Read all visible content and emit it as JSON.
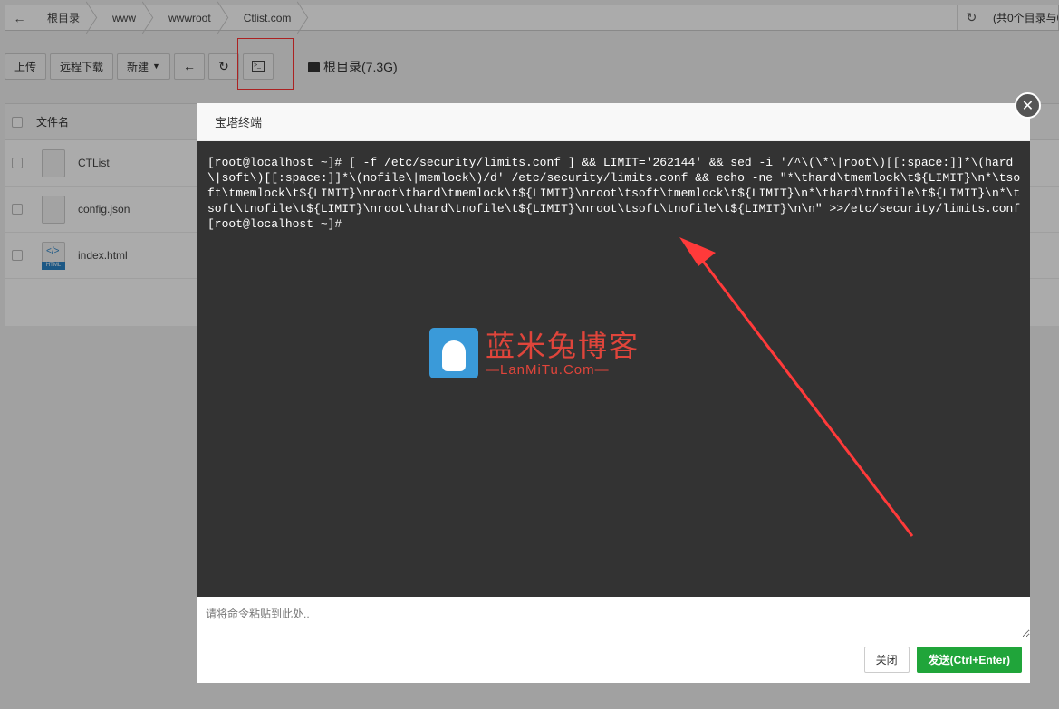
{
  "breadcrumb": {
    "items": [
      "根目录",
      "www",
      "wwwroot",
      "Ctlist.com"
    ],
    "info": "(共0个目录与0"
  },
  "toolbar": {
    "upload": "上传",
    "remote_download": "远程下载",
    "new": "新建",
    "disk_label": "根目录(7.3G)"
  },
  "filelist": {
    "header_name": "文件名",
    "files": [
      {
        "name": "CTList",
        "type": "file"
      },
      {
        "name": "config.json",
        "type": "file"
      },
      {
        "name": "index.html",
        "type": "html",
        "tag": "HTML"
      }
    ]
  },
  "modal": {
    "title": "宝塔终端",
    "terminal_lines": "[root@localhost ~]# [ -f /etc/security/limits.conf ] && LIMIT='262144' && sed -i '/^\\(\\*\\|root\\)[[:space:]]*\\(hard\\|soft\\)[[:space:]]*\\(nofile\\|memlock\\)/d' /etc/security/limits.conf && echo -ne \"*\\thard\\tmemlock\\t${LIMIT}\\n*\\tsoft\\tmemlock\\t${LIMIT}\\nroot\\thard\\tmemlock\\t${LIMIT}\\nroot\\tsoft\\tmemlock\\t${LIMIT}\\n*\\thard\\tnofile\\t${LIMIT}\\n*\\tsoft\\tnofile\\t${LIMIT}\\nroot\\thard\\tnofile\\t${LIMIT}\\nroot\\tsoft\\tnofile\\t${LIMIT}\\n\\n\" >>/etc/security/limits.conf\n[root@localhost ~]#",
    "input_placeholder": "请将命令粘贴到此处..",
    "close_label": "关闭",
    "send_label": "发送(Ctrl+Enter)"
  },
  "watermark": {
    "cn": "蓝米兔博客",
    "en": "—LanMiTu.Com—"
  },
  "colors": {
    "terminal_bg": "#333333",
    "send_green": "#20a53a",
    "annotation_red": "#ff3333"
  }
}
